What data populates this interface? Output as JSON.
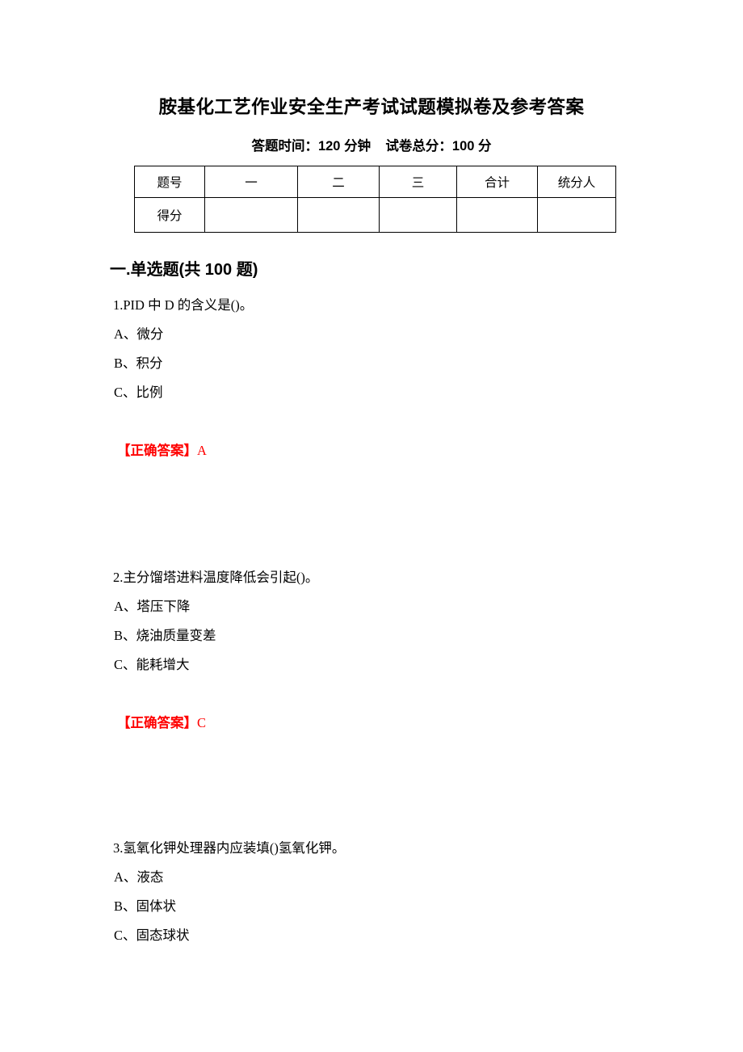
{
  "document": {
    "title": "胺基化工艺作业安全生产考试试题模拟卷及参考答案",
    "subtitle": "答题时间：120 分钟    试卷总分：100 分"
  },
  "score_table": {
    "headers": [
      "题号",
      "一",
      "二",
      "三",
      "合计",
      "统分人"
    ],
    "rows": [
      {
        "label": "得分",
        "cells": [
          "",
          "",
          "",
          "",
          ""
        ]
      }
    ]
  },
  "section": {
    "heading": "一.单选题(共 100 题)"
  },
  "questions": [
    {
      "stem": "1.PID 中 D 的含义是()。",
      "options": [
        "A、微分",
        "B、积分",
        "C、比例"
      ],
      "answer_label": "【正确答案】",
      "answer_value": "A"
    },
    {
      "stem": "2.主分馏塔进料温度降低会引起()。",
      "options": [
        "A、塔压下降",
        "B、烧油质量变差",
        "C、能耗增大"
      ],
      "answer_label": "【正确答案】",
      "answer_value": "C"
    },
    {
      "stem": "3.氢氧化钾处理器内应装填()氢氧化钾。",
      "options": [
        "A、液态",
        "B、固体状",
        "C、固态球状"
      ],
      "answer_label": "",
      "answer_value": ""
    }
  ],
  "colors": {
    "answer_red": "#ff0000",
    "text_black": "#000000",
    "page_background": "#ffffff",
    "table_border": "#000000"
  }
}
